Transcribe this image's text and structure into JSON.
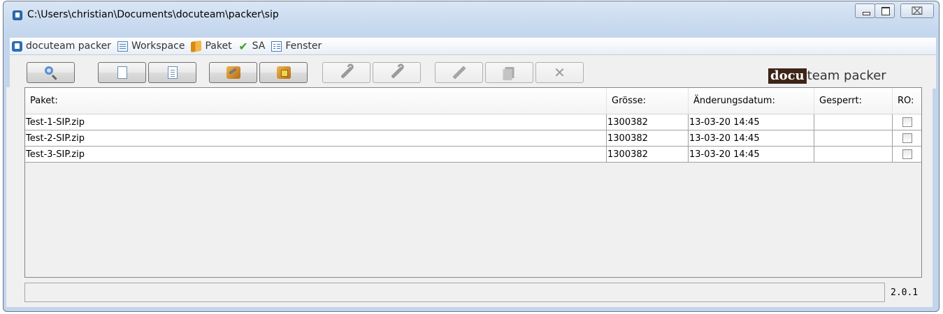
{
  "window": {
    "title": "C:\\Users\\christian\\Documents\\docuteam\\packer\\sip",
    "minimize_label": "",
    "maximize_label": "",
    "close_label": "⌧"
  },
  "menubar": {
    "items": [
      {
        "label": "docuteam packer",
        "icon": "app-icon"
      },
      {
        "label": "Workspace",
        "icon": "workspace-icon"
      },
      {
        "label": "Paket",
        "icon": "package-icon"
      },
      {
        "label": "SA",
        "icon": "checkmark-icon"
      },
      {
        "label": "Fenster",
        "icon": "window-icon"
      }
    ]
  },
  "toolbar": {
    "buttons": [
      {
        "icon": "search-icon",
        "enabled": true
      },
      {
        "icon": "new-document-icon",
        "enabled": true
      },
      {
        "icon": "document-list-icon",
        "enabled": true
      },
      {
        "icon": "package-key-icon",
        "enabled": true
      },
      {
        "icon": "package-lock-icon",
        "enabled": true
      },
      {
        "icon": "wrench-icon",
        "enabled": false
      },
      {
        "icon": "wrench-settings-icon",
        "enabled": false
      },
      {
        "icon": "pencil-icon",
        "enabled": false
      },
      {
        "icon": "copy-icon",
        "enabled": false
      },
      {
        "icon": "delete-icon",
        "enabled": false
      }
    ]
  },
  "brand": {
    "part1": "docu",
    "part2": "team packer"
  },
  "table": {
    "columns": [
      "Paket:",
      "Grösse:",
      "Änderungsdatum:",
      "Gesperrt:",
      "RO:"
    ],
    "rows": [
      {
        "paket": "Test-1-SIP.zip",
        "groesse": "1300382",
        "datum": "13-03-20 14:45",
        "gesperrt": "",
        "ro": false
      },
      {
        "paket": "Test-2-SIP.zip",
        "groesse": "1300382",
        "datum": "13-03-20 14:45",
        "gesperrt": "",
        "ro": false
      },
      {
        "paket": "Test-3-SIP.zip",
        "groesse": "1300382",
        "datum": "13-03-20 14:45",
        "gesperrt": "",
        "ro": false
      }
    ]
  },
  "status": {
    "text": "",
    "version": "2.0.1"
  }
}
